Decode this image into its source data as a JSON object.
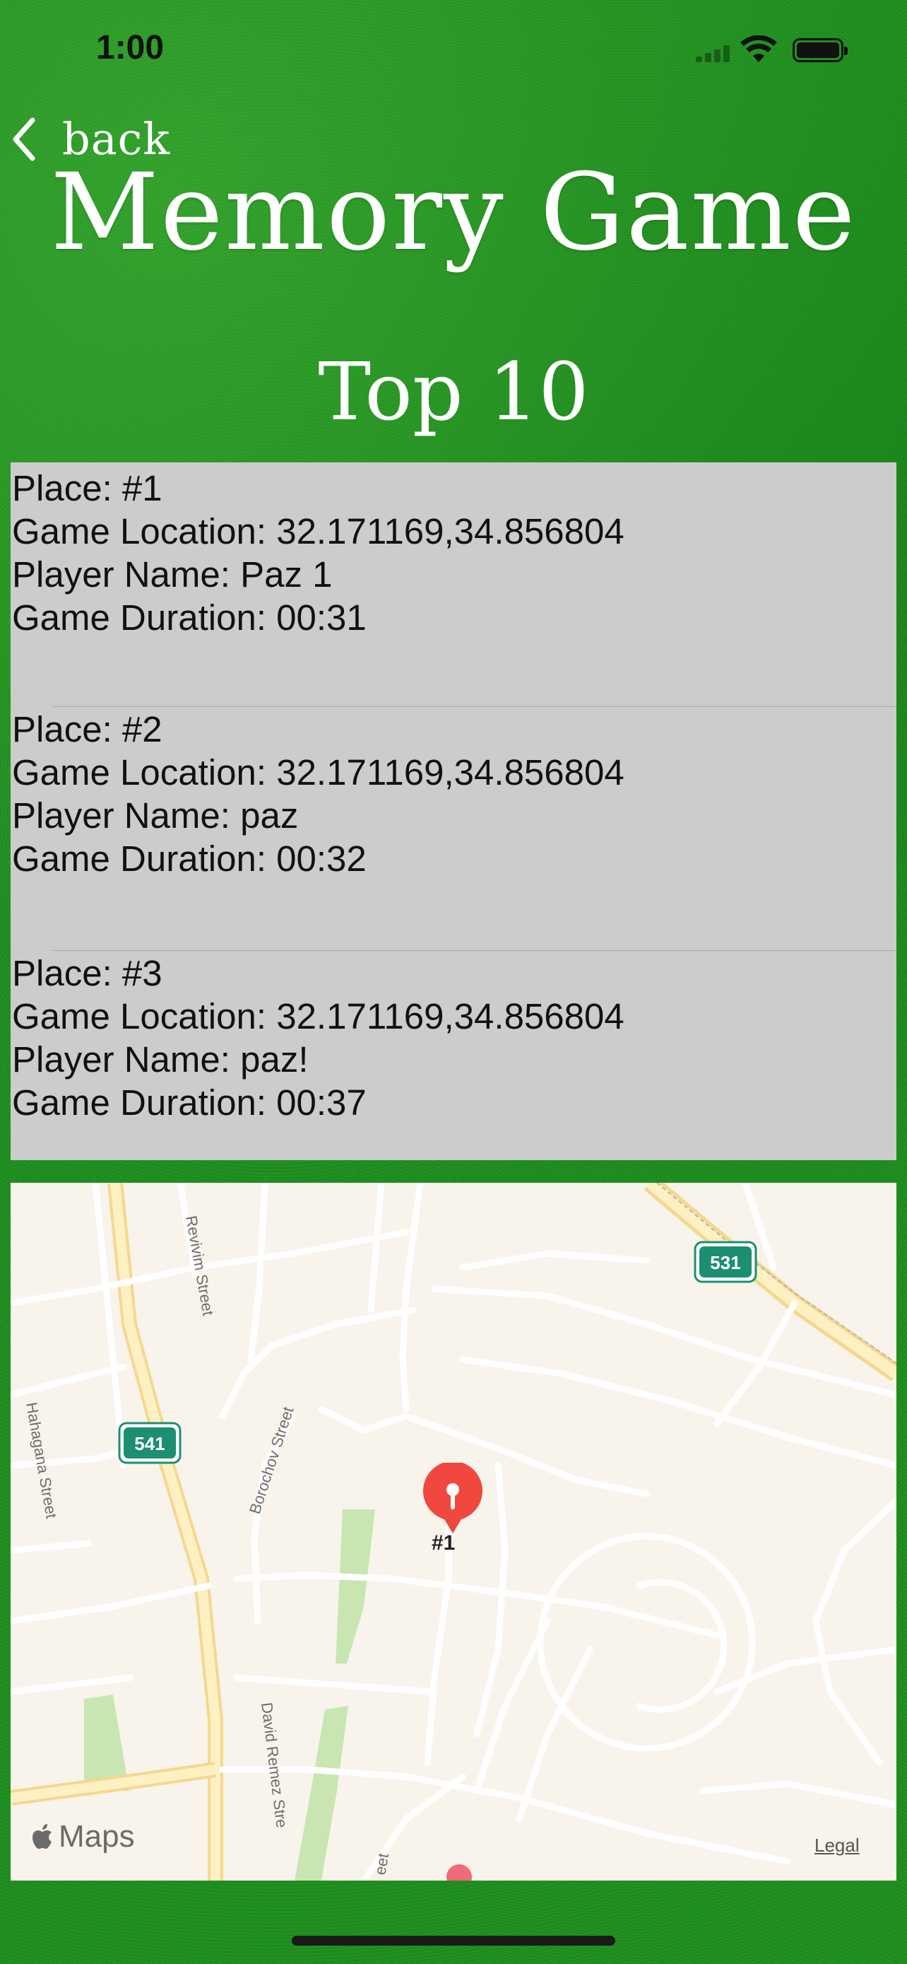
{
  "status_bar": {
    "time": "1:00"
  },
  "nav": {
    "back_label": "back"
  },
  "header": {
    "title": "Memory Game",
    "subtitle": "Top 10"
  },
  "records": [
    {
      "place": "Place: #1",
      "location": "Game Location: 32.171169,34.856804",
      "player": "Player Name: Paz 1",
      "duration": "Game Duration: 00:31"
    },
    {
      "place": "Place: #2",
      "location": "Game Location: 32.171169,34.856804",
      "player": "Player Name: paz",
      "duration": "Game Duration: 00:32"
    },
    {
      "place": "Place: #3",
      "location": "Game Location: 32.171169,34.856804",
      "player": "Player Name: paz!",
      "duration": "Game Duration: 00:37"
    }
  ],
  "map": {
    "pin_label": "#1",
    "pin_color": "#f0483e",
    "streets": [
      "Revivim Street",
      "Borochov Street",
      "Hahagana Street",
      "David Remez Stre",
      "eet"
    ],
    "route_shields": [
      "531",
      "541"
    ],
    "attribution": "Maps",
    "legal": "Legal"
  },
  "colors": {
    "background": "#1e8f1e",
    "list_background": "#cccccc",
    "map_background": "#f8f4ec",
    "shield": "#1c8f72"
  }
}
